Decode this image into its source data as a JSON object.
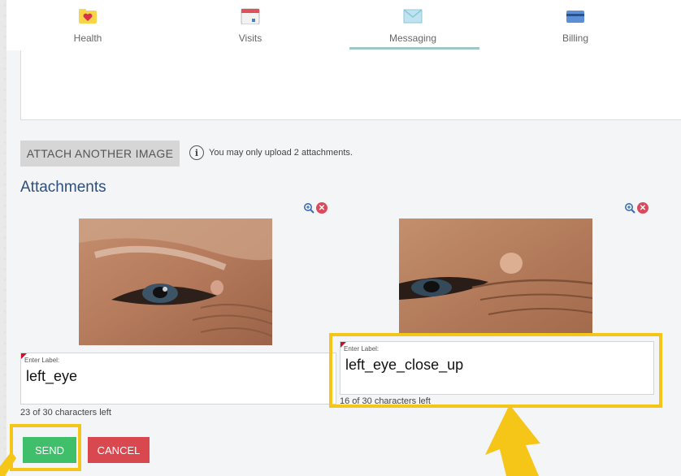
{
  "nav": {
    "tabs": [
      {
        "label": "Health",
        "icon": "heart-folder-icon"
      },
      {
        "label": "Visits",
        "icon": "calendar-icon"
      },
      {
        "label": "Messaging",
        "icon": "envelope-icon",
        "active": true
      },
      {
        "label": "Billing",
        "icon": "credit-card-icon"
      }
    ]
  },
  "attach": {
    "button_label": "ATTACH ANOTHER IMAGE",
    "info_text": "You may only upload 2 attachments."
  },
  "attachments": {
    "title": "Attachments",
    "items": [
      {
        "caption": "Enter Label:",
        "value": "left_eye",
        "chars_left": "23 of 30 characters left"
      },
      {
        "caption": "Enter Label:",
        "value": "left_eye_close_up",
        "chars_left": "16 of 30 characters left"
      }
    ]
  },
  "actions": {
    "send": "SEND",
    "cancel": "CANCEL"
  },
  "colors": {
    "highlight": "#f5c518",
    "send": "#3fbf6a",
    "cancel": "#d9484f",
    "heading": "#2f4f7a"
  }
}
